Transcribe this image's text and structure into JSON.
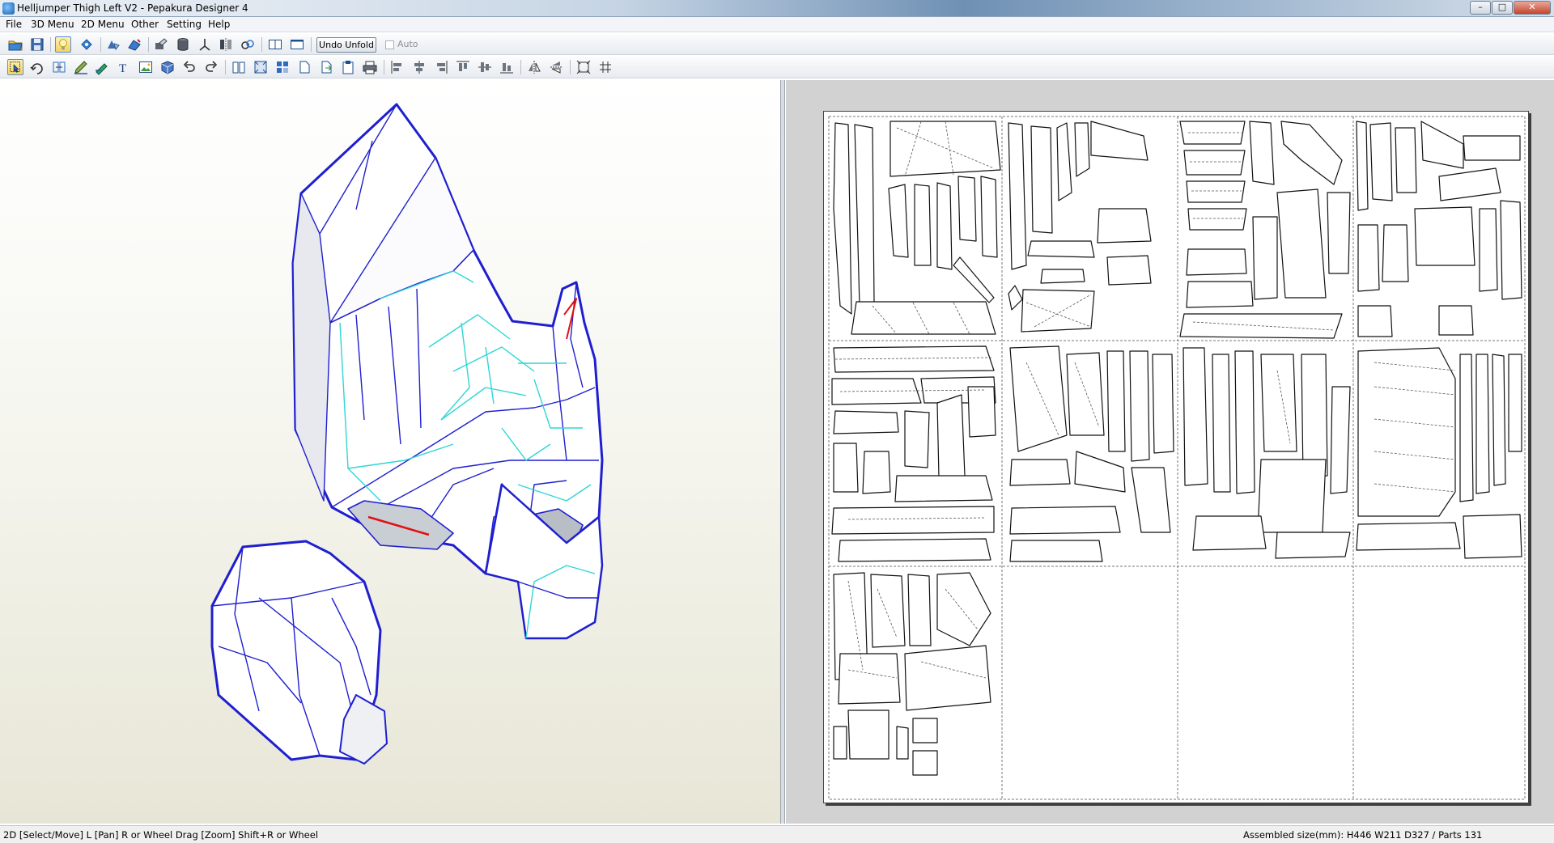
{
  "window": {
    "title": "Helljumper Thigh Left V2 - Pepakura Designer 4",
    "minimize_glyph": "–",
    "maximize_glyph": "□",
    "close_glyph": "✕"
  },
  "menu": [
    "File",
    "3D Menu",
    "2D Menu",
    "Other",
    "Setting",
    "Help"
  ],
  "toolbar1": {
    "icons": [
      "open-icon",
      "save-icon",
      "lightbulb-icon",
      "rotate-model-icon",
      "flip-icon",
      "unfold-icon",
      "edit-edges-icon",
      "cylinder-icon",
      "axis-icon",
      "mirror-icon",
      "link-icon",
      "split-view-icon",
      "single-view-icon"
    ],
    "undo_unfold_label": "Undo Unfold",
    "auto_label": "Auto"
  },
  "toolbar2": {
    "icons": [
      "select-move-icon",
      "rotate-part-icon",
      "join-parts-icon",
      "edit-line-icon",
      "add-flap-icon",
      "text-icon",
      "image-icon",
      "box-icon",
      "undo-icon",
      "redo-icon",
      "book-icon",
      "fit-page-icon",
      "layout-icon",
      "page-icon",
      "export-icon",
      "clipboard-icon",
      "print-icon",
      "align-left-icon",
      "align-center-icon",
      "align-right-icon",
      "align-top-icon",
      "align-middle-icon",
      "align-bottom-icon",
      "flip-h-icon",
      "flip-v-icon",
      "zoom-fit-icon",
      "grid-icon"
    ]
  },
  "status": {
    "left": "2D [Select/Move] L [Pan] R or Wheel Drag [Zoom] Shift+R or Wheel",
    "right": "Assembled size(mm): H446 W211 D327 / Parts 131"
  },
  "colors": {
    "model_edge": "#1f1fd0",
    "model_fold": "#2ed6d6",
    "model_cut": "#e01010",
    "pattern_line": "#000000"
  }
}
